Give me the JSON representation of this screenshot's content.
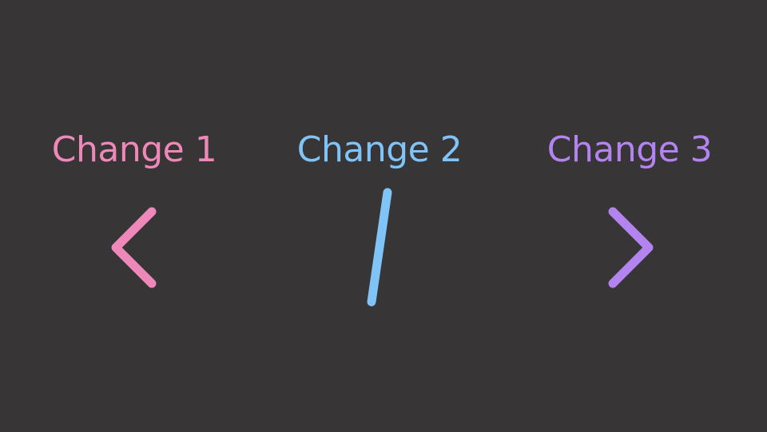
{
  "background_color": "#373536",
  "items": [
    {
      "label": "Change 1",
      "color": "#ee88b9",
      "glyph": "chevron-left-icon"
    },
    {
      "label": "Change 2",
      "color": "#7fc3f7",
      "glyph": "slash-icon"
    },
    {
      "label": "Change 3",
      "color": "#b384ef",
      "glyph": "chevron-right-icon"
    }
  ]
}
